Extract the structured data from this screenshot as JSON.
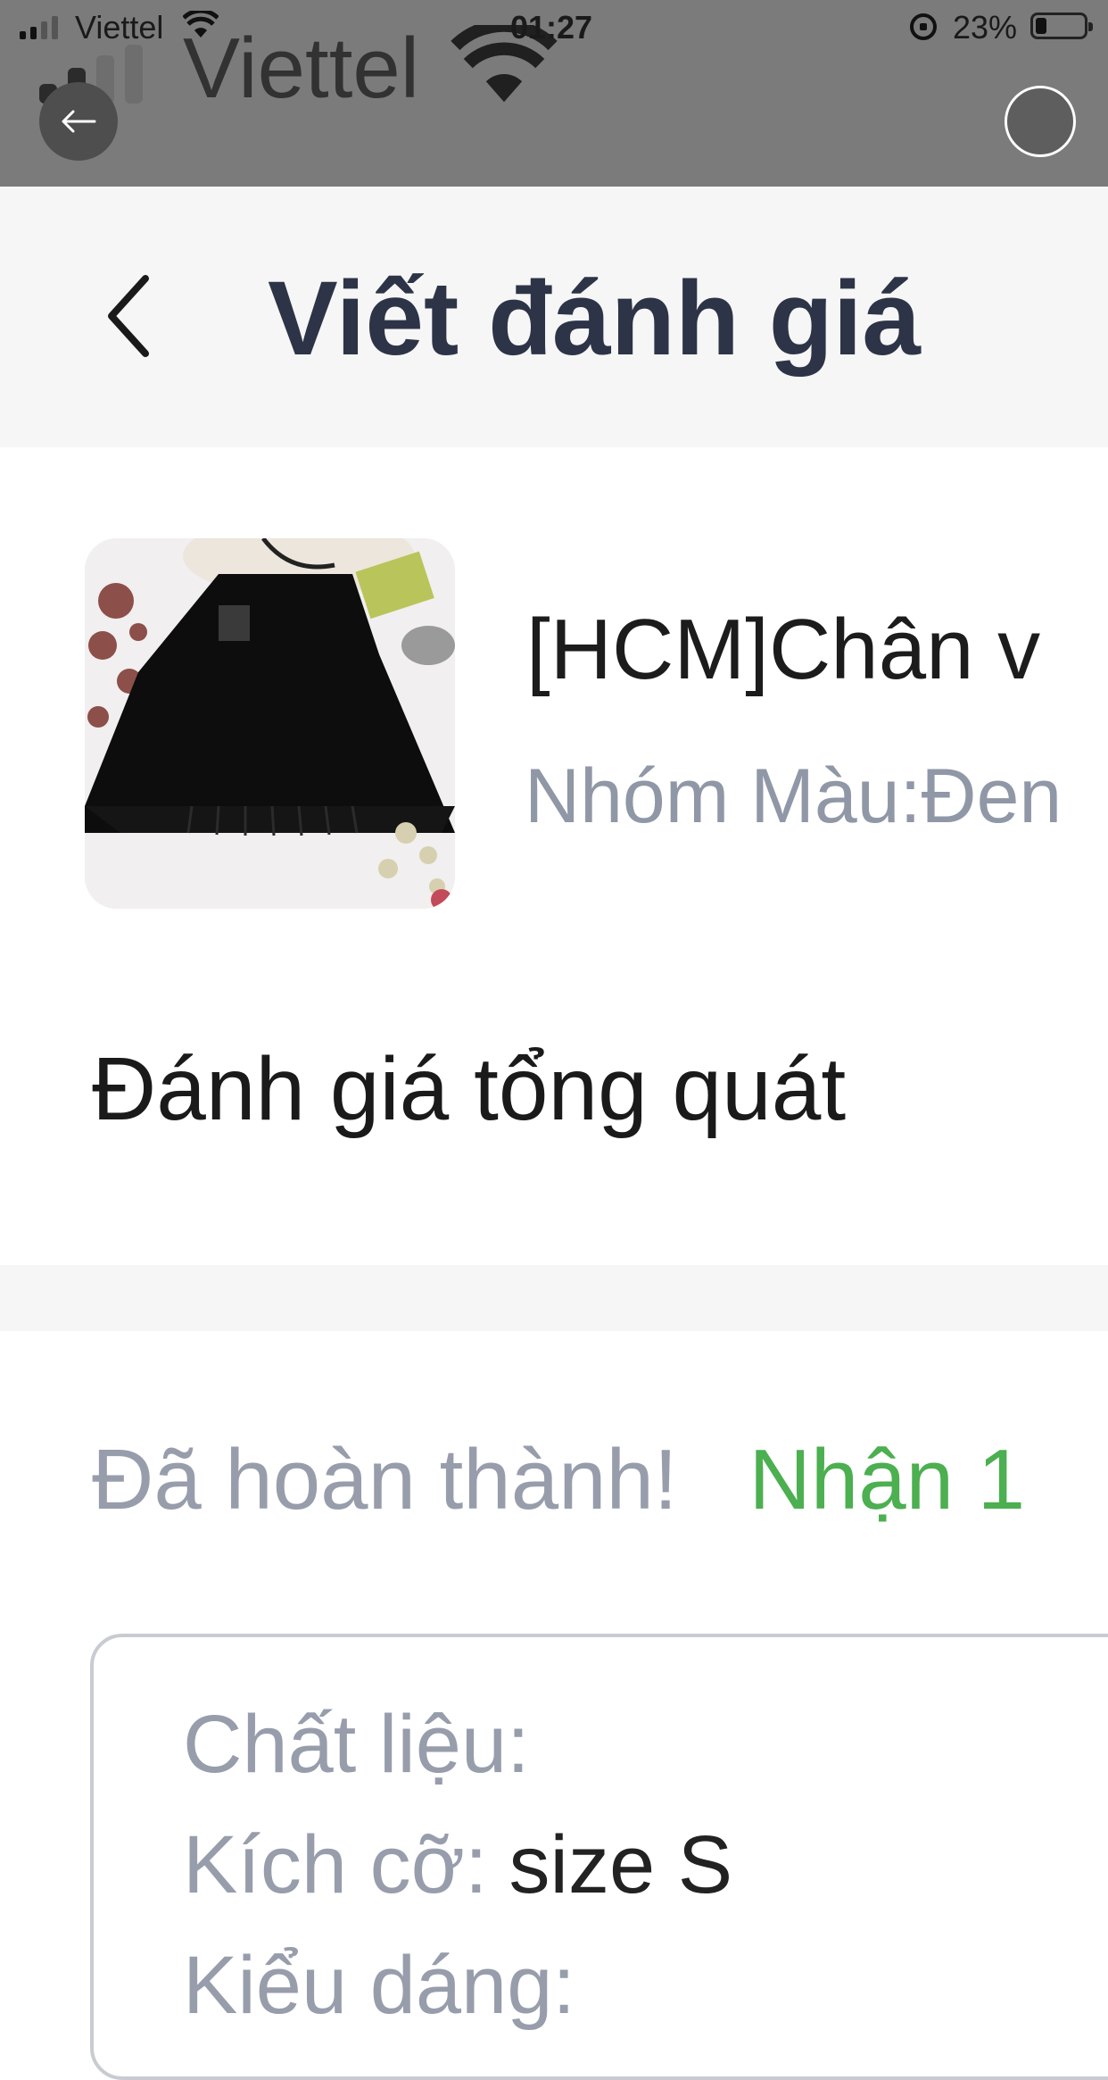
{
  "status_bar": {
    "carrier": "Viettel",
    "time": "01:27",
    "battery_percent": "23%",
    "battery_level": 0.23,
    "overlay_carrier": "Viettel"
  },
  "header": {
    "title": "Viết đánh giá"
  },
  "product": {
    "name": "[HCM]Chân v",
    "variant": "Nhóm Màu:Đen"
  },
  "overall_rating": {
    "title": "Đánh giá tổng quát"
  },
  "completion": {
    "done_text": "Đã hoàn thành!",
    "reward_text": "Nhận 1"
  },
  "review_form": {
    "fields": [
      {
        "label": "Chất liệu:",
        "value": ""
      },
      {
        "label": "Kích cỡ:",
        "value": "size S"
      },
      {
        "label": "Kiểu dáng:",
        "value": ""
      }
    ]
  },
  "colors": {
    "accent_green": "#4caf50",
    "title_dark": "#2e3447",
    "muted_gray": "#979dab"
  }
}
